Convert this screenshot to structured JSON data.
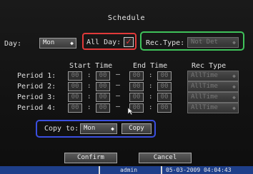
{
  "title": "Schedule",
  "day": {
    "label": "Day:",
    "value": "Mon"
  },
  "all_day": {
    "label": "All Day:",
    "checked_glyph": "✓"
  },
  "rec_type": {
    "label": "Rec.Type:",
    "value": "Not Det"
  },
  "columns": {
    "start": "Start Time",
    "end": "End Time",
    "rec": "Rec Type"
  },
  "periods": [
    {
      "label": "Period 1:",
      "sh": "00",
      "sm": "00",
      "eh": "00",
      "em": "00",
      "rec": "AllTime"
    },
    {
      "label": "Period 2:",
      "sh": "00",
      "sm": "00",
      "eh": "00",
      "em": "00",
      "rec": "AllTime"
    },
    {
      "label": "Period 3:",
      "sh": "00",
      "sm": "00",
      "eh": "00",
      "em": "00",
      "rec": "AllTime"
    },
    {
      "label": "Period 4:",
      "sh": "00",
      "sm": "00",
      "eh": "00",
      "em": "00",
      "rec": "AllTime"
    }
  ],
  "copy": {
    "label": "Copy to:",
    "value": "Mon",
    "button": "Copy"
  },
  "buttons": {
    "confirm": "Confirm",
    "cancel": "Cancel"
  },
  "status": {
    "user": "admin",
    "datetime": "05-03-2009 04:04:43"
  },
  "colors": {
    "highlight_red": "#e23a3a",
    "highlight_green": "#3fc25a",
    "highlight_blue": "#3a4fe0",
    "status_bar": "#1e3f8a"
  },
  "icons": {
    "dropdown": "chevron-updown-icon",
    "cursor": "mouse-pointer-icon"
  }
}
